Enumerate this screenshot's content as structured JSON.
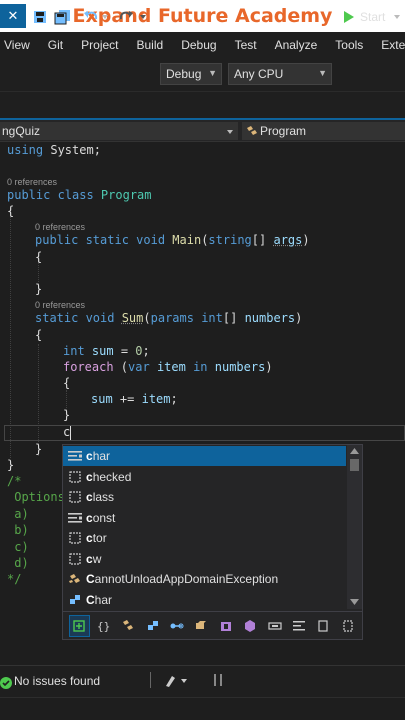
{
  "banner": {
    "title": "Expand Future Academy",
    "color": "#e8672a"
  },
  "menu": [
    "View",
    "Git",
    "Project",
    "Build",
    "Debug",
    "Test",
    "Analyze",
    "Tools",
    "Exten"
  ],
  "toolbar": {
    "config": "Debug",
    "platform": "Any CPU",
    "start_label": "Start",
    "start_color": "#4ec94e"
  },
  "navbar": {
    "left": "ngQuiz",
    "right": "Program"
  },
  "code": {
    "using_kw": "using",
    "using_rest": " System;",
    "ref1": "0 references",
    "class_kw": "public class ",
    "class_name": "Program",
    "brace_open": "{",
    "ref2": "0 references",
    "main_kw": "public static void ",
    "main_name": "Main",
    "main_open": "(",
    "main_type": "string",
    "main_arr": "[] ",
    "main_param": "args",
    "main_close": ")",
    "main_brace_open": "{",
    "main_brace_close": "}",
    "ref3": "0 references",
    "sum_kw": "static void ",
    "sum_name": "Sum",
    "sum_open": "(",
    "sum_params": "params ",
    "sum_type": "int",
    "sum_arr": "[] ",
    "sum_param": "numbers",
    "sum_close": ")",
    "sum_brace_open": "{",
    "decl_kw": "int ",
    "decl_var": "sum",
    "decl_eq": " = ",
    "decl_num": "0",
    "decl_end": ";",
    "foreach_kw": "foreach",
    "foreach_p1": " (",
    "foreach_var": "var ",
    "foreach_item": "item ",
    "foreach_in": "in ",
    "foreach_nums": "numbers",
    "foreach_p2": ")",
    "foreach_brace_open": "{",
    "body_sum": "sum",
    "body_op": " += ",
    "body_item": "item",
    "body_end": ";",
    "foreach_brace_close": "}",
    "typed": "c",
    "sum_brace_close": "}",
    "class_brace_close": "}",
    "comment_open": "/*",
    "comment_options": " Options",
    "comment_a": " a)",
    "comment_b": " b)",
    "comment_c": " c)",
    "comment_d": " d)",
    "comment_close": "*/"
  },
  "completion": {
    "items": [
      {
        "match": "c",
        "rest": "har",
        "icon": "keyword-icon",
        "selected": true
      },
      {
        "match": "c",
        "rest": "hecked",
        "icon": "snippet-icon",
        "selected": false
      },
      {
        "match": "c",
        "rest": "lass",
        "icon": "snippet-icon",
        "selected": false
      },
      {
        "match": "c",
        "rest": "onst",
        "icon": "keyword-icon",
        "selected": false
      },
      {
        "match": "c",
        "rest": "tor",
        "icon": "snippet-icon",
        "selected": false
      },
      {
        "match": "c",
        "rest": "w",
        "icon": "snippet-icon",
        "selected": false
      },
      {
        "match": "C",
        "rest": "annotUnloadAppDomainException",
        "icon": "class-icon",
        "selected": false
      },
      {
        "match": "C",
        "rest": "har",
        "icon": "struct-icon",
        "selected": false
      }
    ],
    "filters": [
      "snippet-expand-icon",
      "namespace-filter-icon",
      "class-filter-icon",
      "struct-filter-icon",
      "interface-filter-icon",
      "delegate-filter-icon",
      "enum-filter-icon",
      "module-filter-icon",
      "extension-filter-icon",
      "target-typed-filter-icon",
      "keyword-filter-icon",
      "snippet-filter-icon"
    ]
  },
  "status": {
    "issues": "No issues found"
  }
}
